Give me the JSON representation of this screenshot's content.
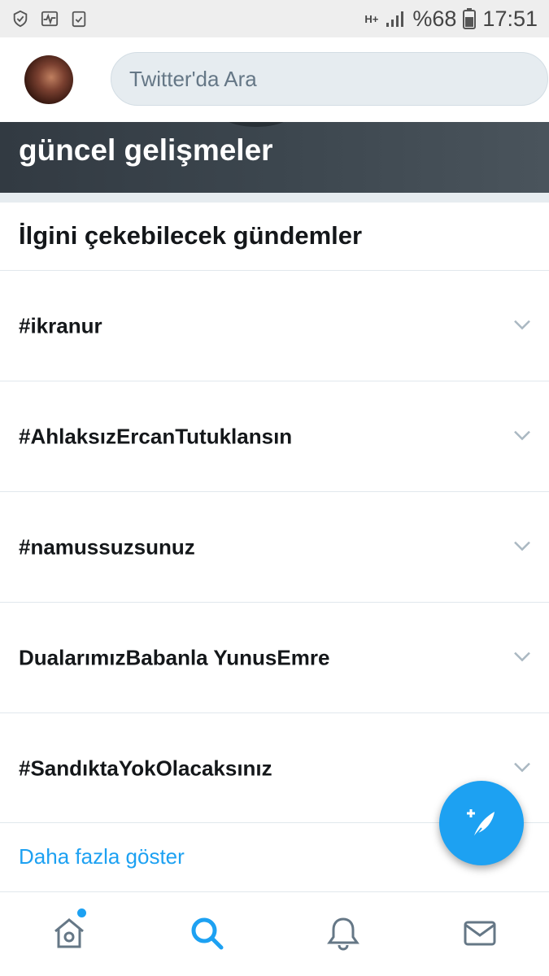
{
  "status_bar": {
    "network": "H+",
    "battery_percent": "%68",
    "time": "17:51"
  },
  "search": {
    "placeholder": "Twitter'da Ara"
  },
  "banner": {
    "title": "güncel gelişmeler"
  },
  "trends": {
    "title": "İlgini çekebilecek gündemler",
    "items": [
      {
        "label": "#ikranur"
      },
      {
        "label": "#AhlaksızErcanTutuklansın"
      },
      {
        "label": "#namussuzsunuz"
      },
      {
        "label": "DualarımızBabanla YunusEmre"
      },
      {
        "label": "#SandıktaYokOlacaksınız"
      }
    ],
    "show_more": "Daha fazla göster"
  },
  "nav": {
    "active": "search",
    "home_has_notification": true
  },
  "colors": {
    "accent": "#1da1f2",
    "search_bg": "#e6ecf0",
    "text": "#14171a",
    "muted": "#657786"
  }
}
